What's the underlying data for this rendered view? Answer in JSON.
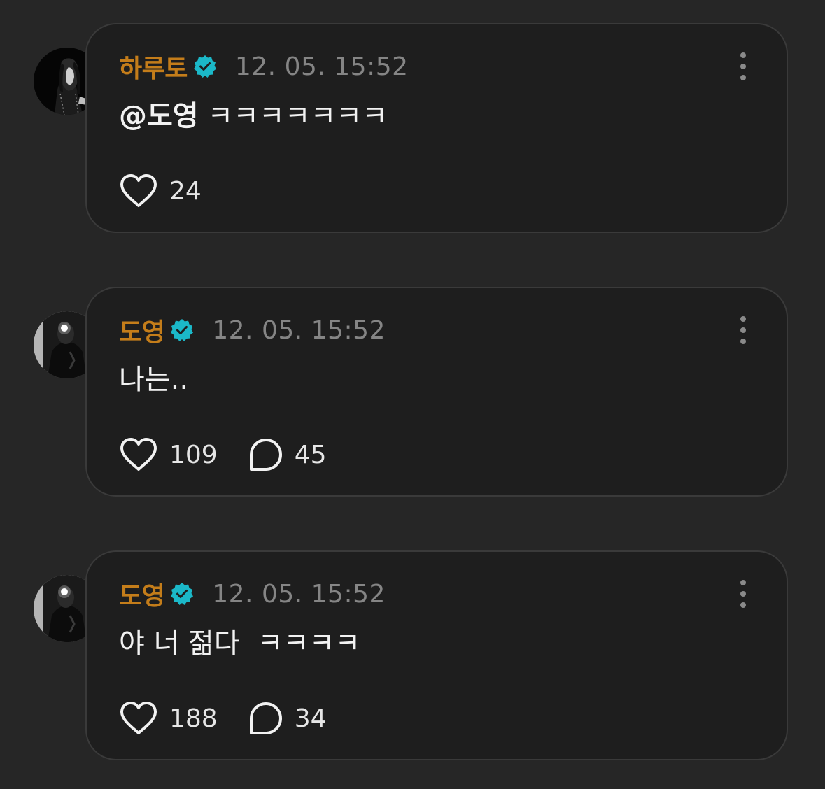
{
  "colors": {
    "background": "#262626",
    "card_background": "#1e1e1e",
    "card_border": "#3a3a3a",
    "username": "#c47d1a",
    "verified_badge": "#1bb8c8",
    "timestamp": "#858585",
    "text": "#f2f2f2"
  },
  "comments": [
    {
      "username": "하루토",
      "verified_icon": "verified-badge-icon",
      "timestamp": "12. 05. 15:52",
      "mention": "@도영",
      "text": " ㅋㅋㅋㅋㅋㅋㅋ",
      "likes": "24",
      "replies": null
    },
    {
      "username": "도영",
      "verified_icon": "verified-badge-icon",
      "timestamp": "12. 05. 15:52",
      "mention": "",
      "text": "나는..",
      "likes": "109",
      "replies": "45"
    },
    {
      "username": "도영",
      "verified_icon": "verified-badge-icon",
      "timestamp": "12. 05. 15:52",
      "mention": "",
      "text": "야 너 젊다  ㅋㅋㅋㅋ",
      "likes": "188",
      "replies": "34"
    }
  ]
}
